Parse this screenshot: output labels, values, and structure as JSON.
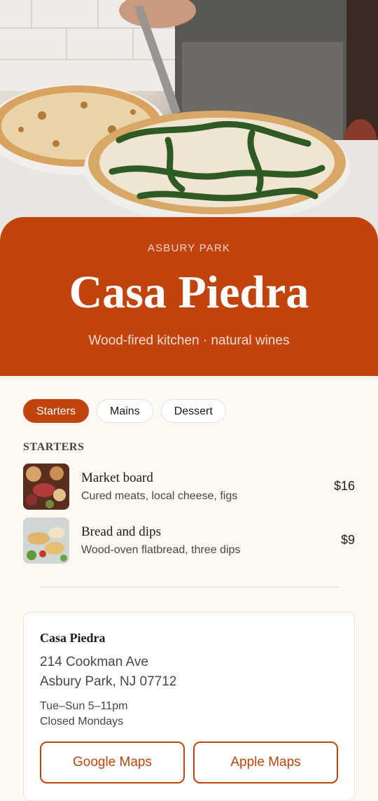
{
  "hero": {
    "image": "pizza-hero-photo"
  },
  "header": {
    "eyebrow": "ASBURY PARK",
    "title": "Casa Piedra",
    "subtitle": "Wood-fired kitchen · natural wines",
    "background_color": "#c1440e"
  },
  "tabs": [
    {
      "label": "Starters",
      "active": true
    },
    {
      "label": "Mains",
      "active": false
    },
    {
      "label": "Dessert",
      "active": false
    }
  ],
  "menu": {
    "section_label": "STARTERS",
    "items": [
      {
        "name": "Market board",
        "description": "Cured meats, local cheese, figs",
        "price": "$16",
        "thumb": "charcuterie-photo"
      },
      {
        "name": "Bread and dips",
        "description": "Wood-oven flatbread, three dips",
        "price": "$9",
        "thumb": "bread-dips-photo"
      }
    ]
  },
  "info": {
    "name": "Casa Piedra",
    "address_line1": "214 Cookman Ave",
    "address_line2": "Asbury Park, NJ 07712",
    "hours_line1": "Tue–Sun 5–11pm",
    "hours_line2": "Closed Mondays",
    "google_maps_label": "Google Maps",
    "apple_maps_label": "Apple Maps"
  },
  "colors": {
    "accent": "#c1440e",
    "page_background": "#fdf9f2"
  }
}
